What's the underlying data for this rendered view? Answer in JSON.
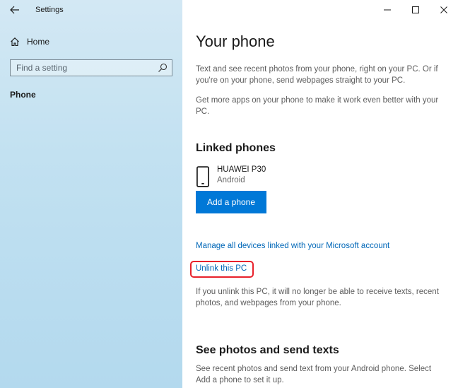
{
  "window": {
    "title": "Settings"
  },
  "sidebar": {
    "home_label": "Home",
    "search_placeholder": "Find a setting",
    "active_item": "Phone"
  },
  "main": {
    "title": "Your phone",
    "description_1": "Text and see recent photos from your phone, right on your PC. Or if you're on your phone, send webpages straight to your PC.",
    "description_2": "Get more apps on your phone to make it work even better with your PC.",
    "linked_phones_heading": "Linked phones",
    "device": {
      "name": "HUAWEI P30",
      "os": "Android",
      "icon": "phone-icon"
    },
    "add_phone_label": "Add a phone",
    "manage_link": "Manage all devices linked with your Microsoft account",
    "unlink_link": "Unlink this PC",
    "unlink_description": "If you unlink this PC, it will no longer be able to receive texts, recent photos, and webpages from your phone.",
    "photos_heading": "See photos and send texts",
    "photos_description": "See recent photos and send text from your Android phone. Select Add a phone to set it up."
  },
  "colors": {
    "accent": "#0078d7",
    "link": "#0067b8",
    "highlight": "#e8212b",
    "sidebar_bg": "#c2e1f1"
  }
}
